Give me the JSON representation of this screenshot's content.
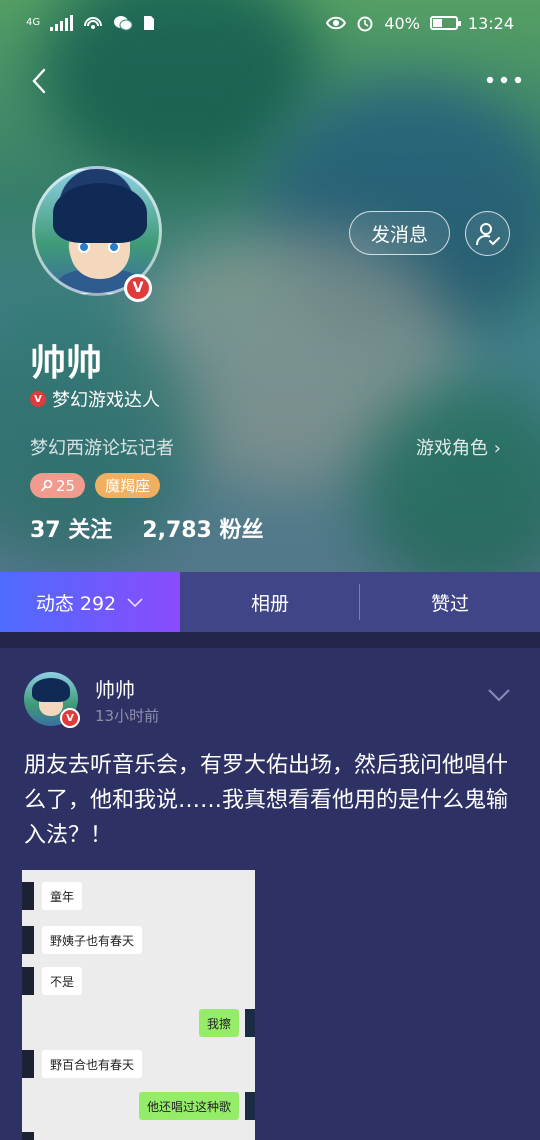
{
  "status_bar": {
    "network": "4G",
    "battery_percent": "40%",
    "battery_level": 0.4,
    "time": "13:24"
  },
  "profile": {
    "name": "帅帅",
    "verified_badge": "V",
    "title": "梦幻游戏达人",
    "subtitle": "梦幻西游论坛记者",
    "game_role_link": "游戏角色 ›",
    "tags": {
      "level": "25",
      "zodiac": "魔羯座"
    },
    "stats": {
      "following": "37 关注",
      "fans": "2,783 粉丝"
    },
    "buttons": {
      "message": "发消息"
    }
  },
  "tabs": [
    {
      "label": "动态 292",
      "active": true
    },
    {
      "label": "相册",
      "active": false
    },
    {
      "label": "赞过",
      "active": false
    }
  ],
  "post": {
    "user": "帅帅",
    "time": "13小时前",
    "text": "朋友去听音乐会，有罗大佑出场，然后我问他唱什么了，他和我说……我真想看看他用的是什么鬼输入法？！",
    "chat": [
      {
        "side": "in",
        "text": "童年"
      },
      {
        "side": "in",
        "text": "野姨子也有春天"
      },
      {
        "side": "in",
        "text": "不是"
      },
      {
        "side": "out",
        "text": "我擦"
      },
      {
        "side": "in",
        "text": "野百合也有春天"
      },
      {
        "side": "out",
        "text": "他还唱过这种歌"
      }
    ]
  },
  "colors": {
    "tab_active_start": "#4e6bff",
    "tab_active_end": "#8a4bff",
    "page_bg": "#2e3163",
    "verified_red": "#e03b3b",
    "tag_level": "#f19b8e",
    "tag_zodiac": "#f0b060"
  }
}
